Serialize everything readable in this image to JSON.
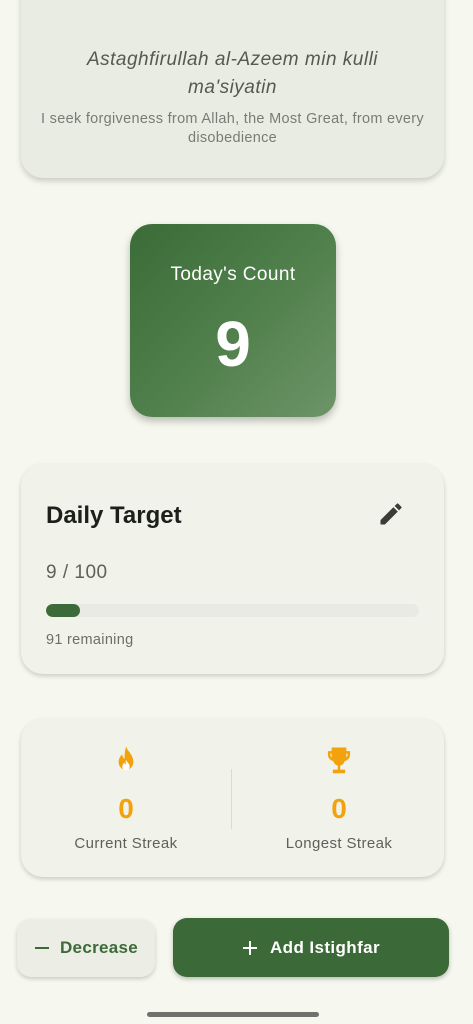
{
  "dhikr": {
    "transliteration_line1": "Astaghfirullah al-Azeem min kulli",
    "transliteration_line2": "ma'siyatin",
    "translation": "I seek forgiveness from Allah, the Most Great, from every disobedience"
  },
  "today": {
    "label": "Today's Count",
    "count": "9"
  },
  "daily_target": {
    "title": "Daily Target",
    "edit_icon": "pencil-icon",
    "progress_text": "9 / 100",
    "progress_fraction": 0.09,
    "remaining_text": "91 remaining"
  },
  "streaks": {
    "current": {
      "icon": "flame-icon",
      "value": "0",
      "label": "Current Streak"
    },
    "longest": {
      "icon": "trophy-icon",
      "value": "0",
      "label": "Longest Streak"
    }
  },
  "actions": {
    "decrease_label": "Decrease",
    "add_label": "Add Istighfar"
  },
  "colors": {
    "primary": "#3b6937",
    "accent": "#f2a20c",
    "background": "#f6f8ef"
  }
}
